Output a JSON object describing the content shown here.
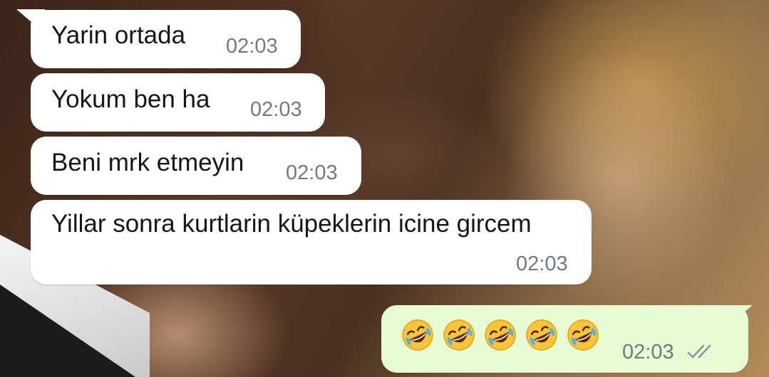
{
  "messages": [
    {
      "direction": "incoming",
      "text": "Yarin ortada",
      "time": "02:03"
    },
    {
      "direction": "incoming",
      "text": "Yokum ben ha",
      "time": "02:03"
    },
    {
      "direction": "incoming",
      "text": "Beni mrk etmeyin",
      "time": "02:03"
    },
    {
      "direction": "incoming",
      "text": "Yillar sonra kurtlarin küpeklerin icine gircem",
      "time": "02:03"
    },
    {
      "direction": "outgoing",
      "emoji": "rolling-on-the-floor-laughing",
      "emoji_count": 5,
      "time": "02:03",
      "status": "read-double-tick-icon"
    }
  ],
  "colors": {
    "incoming_bubble": "#ffffff",
    "outgoing_bubble": "#e6fbd2",
    "text": "#161616",
    "time": "#6f7a83",
    "tick": "#8a959e"
  }
}
